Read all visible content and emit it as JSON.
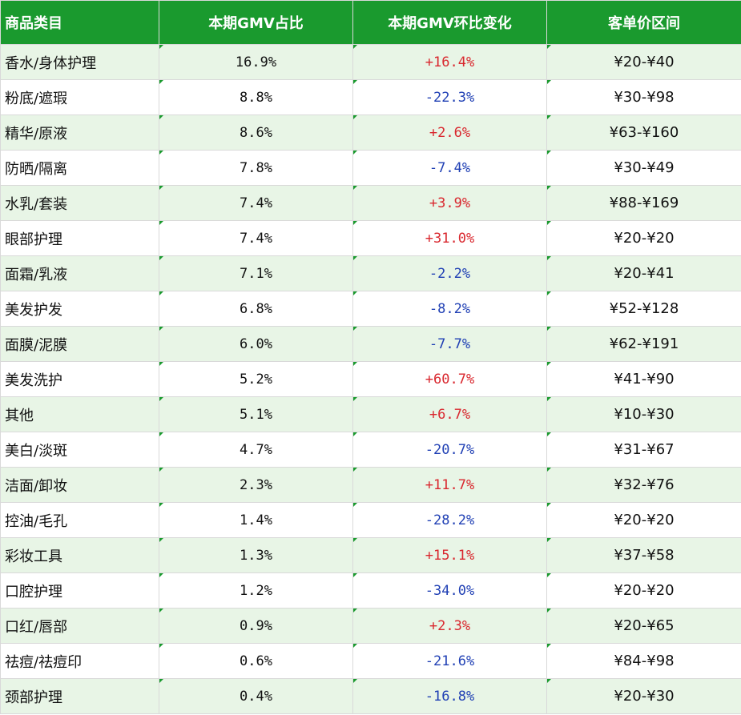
{
  "table": {
    "headers": [
      "商品类目",
      "本期GMV占比",
      "本期GMV环比变化",
      "客单价区间"
    ],
    "colors": {
      "header_bg": "#1a9a2e",
      "positive": "#d9272e",
      "negative": "#1f3fb4"
    },
    "rows": [
      {
        "category": "香水/身体护理",
        "share": "16.9%",
        "change": "+16.4%",
        "price": "¥20-¥40"
      },
      {
        "category": "粉底/遮瑕",
        "share": "8.8%",
        "change": "-22.3%",
        "price": "¥30-¥98"
      },
      {
        "category": "精华/原液",
        "share": "8.6%",
        "change": "+2.6%",
        "price": "¥63-¥160"
      },
      {
        "category": "防晒/隔离",
        "share": "7.8%",
        "change": "-7.4%",
        "price": "¥30-¥49"
      },
      {
        "category": "水乳/套装",
        "share": "7.4%",
        "change": "+3.9%",
        "price": "¥88-¥169"
      },
      {
        "category": "眼部护理",
        "share": "7.4%",
        "change": "+31.0%",
        "price": "¥20-¥20"
      },
      {
        "category": "面霜/乳液",
        "share": "7.1%",
        "change": "-2.2%",
        "price": "¥20-¥41"
      },
      {
        "category": "美发护发",
        "share": "6.8%",
        "change": "-8.2%",
        "price": "¥52-¥128"
      },
      {
        "category": "面膜/泥膜",
        "share": "6.0%",
        "change": "-7.7%",
        "price": "¥62-¥191"
      },
      {
        "category": "美发洗护",
        "share": "5.2%",
        "change": "+60.7%",
        "price": "¥41-¥90"
      },
      {
        "category": "其他",
        "share": "5.1%",
        "change": "+6.7%",
        "price": "¥10-¥30"
      },
      {
        "category": "美白/淡斑",
        "share": "4.7%",
        "change": "-20.7%",
        "price": "¥31-¥67"
      },
      {
        "category": "洁面/卸妆",
        "share": "2.3%",
        "change": "+11.7%",
        "price": "¥32-¥76"
      },
      {
        "category": "控油/毛孔",
        "share": "1.4%",
        "change": "-28.2%",
        "price": "¥20-¥20"
      },
      {
        "category": "彩妆工具",
        "share": "1.3%",
        "change": "+15.1%",
        "price": "¥37-¥58"
      },
      {
        "category": "口腔护理",
        "share": "1.2%",
        "change": "-34.0%",
        "price": "¥20-¥20"
      },
      {
        "category": "口红/唇部",
        "share": "0.9%",
        "change": "+2.3%",
        "price": "¥20-¥65"
      },
      {
        "category": "祛痘/祛痘印",
        "share": "0.6%",
        "change": "-21.6%",
        "price": "¥84-¥98"
      },
      {
        "category": "颈部护理",
        "share": "0.4%",
        "change": "-16.8%",
        "price": "¥20-¥30"
      }
    ]
  }
}
